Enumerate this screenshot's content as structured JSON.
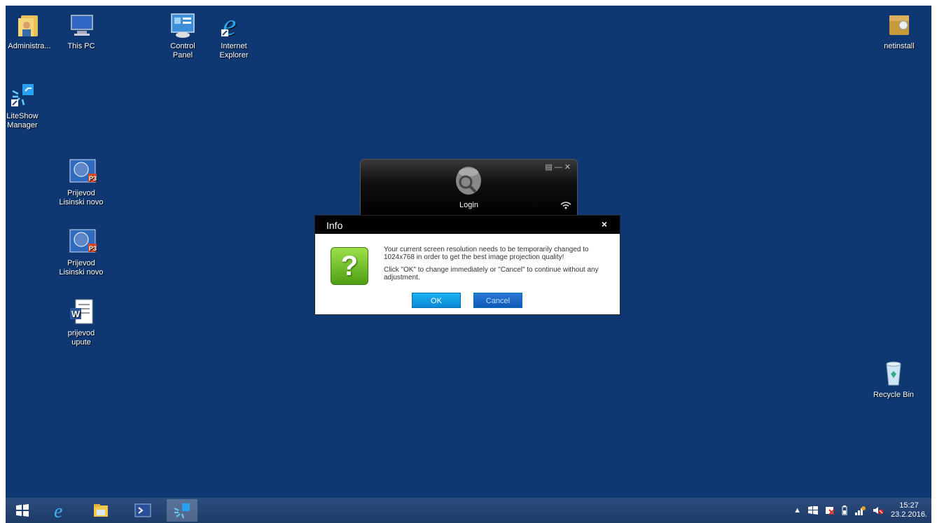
{
  "desktop_icons": [
    {
      "label": "Administra...",
      "icon": "user-folder-icon"
    },
    {
      "label": "This PC",
      "icon": "computer-icon"
    },
    {
      "label": "Control Panel",
      "icon": "control-panel-icon"
    },
    {
      "label": "Internet Explorer",
      "icon": "internet-explorer-icon"
    },
    {
      "label": "netinstall",
      "icon": "package-icon"
    },
    {
      "label": "LiteShow Manager",
      "icon": "liteshow-icon"
    },
    {
      "label": "Prijevod Lisinski novo",
      "icon": "powerpoint-icon"
    },
    {
      "label": "Prijevod Lisinski novo",
      "icon": "powerpoint-icon"
    },
    {
      "label": "prijevod upute",
      "icon": "word-icon"
    },
    {
      "label": "Recycle Bin",
      "icon": "recycle-bin-icon"
    }
  ],
  "liteshow": {
    "login_label": "Login"
  },
  "dialog": {
    "title": "Info",
    "close": "×",
    "message_1": "Your current screen resolution needs to be temporarily changed to 1024x768 in order to get the best image projection quality!",
    "message_2": "Click \"OK\" to change immediately or \"Cancel\" to continue without any adjustment.",
    "ok_label": "OK",
    "cancel_label": "Cancel"
  },
  "taskbar": {
    "items": [
      "windows-start-icon",
      "internet-explorer-icon",
      "file-explorer-icon",
      "powershell-icon",
      "liteshow-icon"
    ],
    "clock_time": "15:27",
    "clock_date": "23.2.2016."
  },
  "colors": {
    "desktop": "#0f3873",
    "accent_button": "#1bb2f2"
  }
}
